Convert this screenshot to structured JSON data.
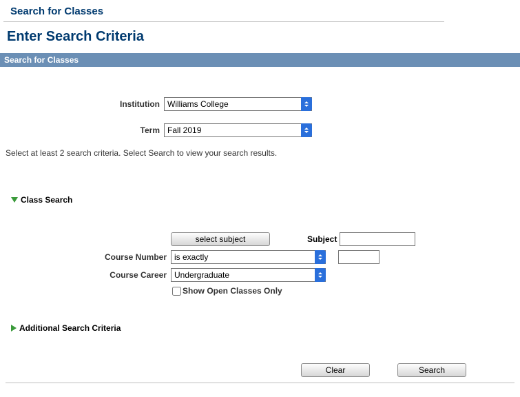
{
  "page": {
    "title": "Search for Classes",
    "subtitle": "Enter Search Criteria",
    "section_bar": "Search for Classes"
  },
  "form": {
    "institution_label": "Institution",
    "institution_value": "Williams College",
    "term_label": "Term",
    "term_value": "Fall 2019",
    "instructions": "Select at least 2 search criteria. Select Search to view your search results."
  },
  "class_search": {
    "header": "Class Search",
    "select_subject_btn": "select subject",
    "subject_label": "Subject",
    "subject_value": "",
    "course_number_label": "Course Number",
    "course_number_op": "is exactly",
    "course_number_value": "",
    "course_career_label": "Course Career",
    "course_career_value": "Undergraduate",
    "show_open_label": "Show Open Classes Only"
  },
  "additional": {
    "header": "Additional Search Criteria"
  },
  "actions": {
    "clear": "Clear",
    "search": "Search"
  }
}
